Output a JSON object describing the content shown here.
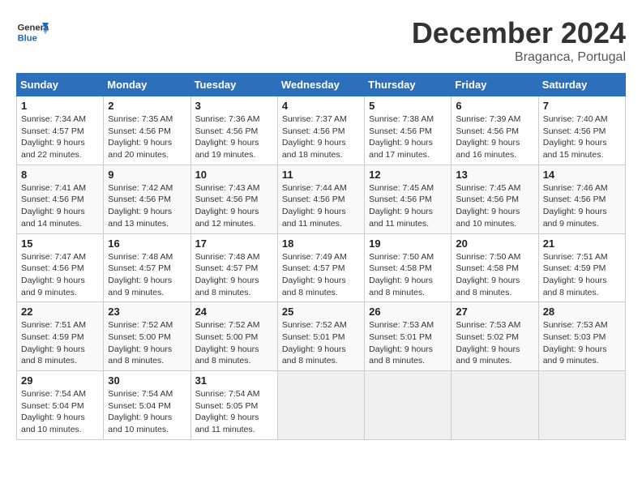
{
  "header": {
    "logo_general": "General",
    "logo_blue": "Blue",
    "month_title": "December 2024",
    "location": "Braganca, Portugal"
  },
  "weekdays": [
    "Sunday",
    "Monday",
    "Tuesday",
    "Wednesday",
    "Thursday",
    "Friday",
    "Saturday"
  ],
  "weeks": [
    [
      {
        "day": "1",
        "sunrise": "Sunrise: 7:34 AM",
        "sunset": "Sunset: 4:57 PM",
        "daylight": "Daylight: 9 hours and 22 minutes."
      },
      {
        "day": "2",
        "sunrise": "Sunrise: 7:35 AM",
        "sunset": "Sunset: 4:56 PM",
        "daylight": "Daylight: 9 hours and 20 minutes."
      },
      {
        "day": "3",
        "sunrise": "Sunrise: 7:36 AM",
        "sunset": "Sunset: 4:56 PM",
        "daylight": "Daylight: 9 hours and 19 minutes."
      },
      {
        "day": "4",
        "sunrise": "Sunrise: 7:37 AM",
        "sunset": "Sunset: 4:56 PM",
        "daylight": "Daylight: 9 hours and 18 minutes."
      },
      {
        "day": "5",
        "sunrise": "Sunrise: 7:38 AM",
        "sunset": "Sunset: 4:56 PM",
        "daylight": "Daylight: 9 hours and 17 minutes."
      },
      {
        "day": "6",
        "sunrise": "Sunrise: 7:39 AM",
        "sunset": "Sunset: 4:56 PM",
        "daylight": "Daylight: 9 hours and 16 minutes."
      },
      {
        "day": "7",
        "sunrise": "Sunrise: 7:40 AM",
        "sunset": "Sunset: 4:56 PM",
        "daylight": "Daylight: 9 hours and 15 minutes."
      }
    ],
    [
      {
        "day": "8",
        "sunrise": "Sunrise: 7:41 AM",
        "sunset": "Sunset: 4:56 PM",
        "daylight": "Daylight: 9 hours and 14 minutes."
      },
      {
        "day": "9",
        "sunrise": "Sunrise: 7:42 AM",
        "sunset": "Sunset: 4:56 PM",
        "daylight": "Daylight: 9 hours and 13 minutes."
      },
      {
        "day": "10",
        "sunrise": "Sunrise: 7:43 AM",
        "sunset": "Sunset: 4:56 PM",
        "daylight": "Daylight: 9 hours and 12 minutes."
      },
      {
        "day": "11",
        "sunrise": "Sunrise: 7:44 AM",
        "sunset": "Sunset: 4:56 PM",
        "daylight": "Daylight: 9 hours and 11 minutes."
      },
      {
        "day": "12",
        "sunrise": "Sunrise: 7:45 AM",
        "sunset": "Sunset: 4:56 PM",
        "daylight": "Daylight: 9 hours and 11 minutes."
      },
      {
        "day": "13",
        "sunrise": "Sunrise: 7:45 AM",
        "sunset": "Sunset: 4:56 PM",
        "daylight": "Daylight: 9 hours and 10 minutes."
      },
      {
        "day": "14",
        "sunrise": "Sunrise: 7:46 AM",
        "sunset": "Sunset: 4:56 PM",
        "daylight": "Daylight: 9 hours and 9 minutes."
      }
    ],
    [
      {
        "day": "15",
        "sunrise": "Sunrise: 7:47 AM",
        "sunset": "Sunset: 4:56 PM",
        "daylight": "Daylight: 9 hours and 9 minutes."
      },
      {
        "day": "16",
        "sunrise": "Sunrise: 7:48 AM",
        "sunset": "Sunset: 4:57 PM",
        "daylight": "Daylight: 9 hours and 9 minutes."
      },
      {
        "day": "17",
        "sunrise": "Sunrise: 7:48 AM",
        "sunset": "Sunset: 4:57 PM",
        "daylight": "Daylight: 9 hours and 8 minutes."
      },
      {
        "day": "18",
        "sunrise": "Sunrise: 7:49 AM",
        "sunset": "Sunset: 4:57 PM",
        "daylight": "Daylight: 9 hours and 8 minutes."
      },
      {
        "day": "19",
        "sunrise": "Sunrise: 7:50 AM",
        "sunset": "Sunset: 4:58 PM",
        "daylight": "Daylight: 9 hours and 8 minutes."
      },
      {
        "day": "20",
        "sunrise": "Sunrise: 7:50 AM",
        "sunset": "Sunset: 4:58 PM",
        "daylight": "Daylight: 9 hours and 8 minutes."
      },
      {
        "day": "21",
        "sunrise": "Sunrise: 7:51 AM",
        "sunset": "Sunset: 4:59 PM",
        "daylight": "Daylight: 9 hours and 8 minutes."
      }
    ],
    [
      {
        "day": "22",
        "sunrise": "Sunrise: 7:51 AM",
        "sunset": "Sunset: 4:59 PM",
        "daylight": "Daylight: 9 hours and 8 minutes."
      },
      {
        "day": "23",
        "sunrise": "Sunrise: 7:52 AM",
        "sunset": "Sunset: 5:00 PM",
        "daylight": "Daylight: 9 hours and 8 minutes."
      },
      {
        "day": "24",
        "sunrise": "Sunrise: 7:52 AM",
        "sunset": "Sunset: 5:00 PM",
        "daylight": "Daylight: 9 hours and 8 minutes."
      },
      {
        "day": "25",
        "sunrise": "Sunrise: 7:52 AM",
        "sunset": "Sunset: 5:01 PM",
        "daylight": "Daylight: 9 hours and 8 minutes."
      },
      {
        "day": "26",
        "sunrise": "Sunrise: 7:53 AM",
        "sunset": "Sunset: 5:01 PM",
        "daylight": "Daylight: 9 hours and 8 minutes."
      },
      {
        "day": "27",
        "sunrise": "Sunrise: 7:53 AM",
        "sunset": "Sunset: 5:02 PM",
        "daylight": "Daylight: 9 hours and 9 minutes."
      },
      {
        "day": "28",
        "sunrise": "Sunrise: 7:53 AM",
        "sunset": "Sunset: 5:03 PM",
        "daylight": "Daylight: 9 hours and 9 minutes."
      }
    ],
    [
      {
        "day": "29",
        "sunrise": "Sunrise: 7:54 AM",
        "sunset": "Sunset: 5:04 PM",
        "daylight": "Daylight: 9 hours and 10 minutes."
      },
      {
        "day": "30",
        "sunrise": "Sunrise: 7:54 AM",
        "sunset": "Sunset: 5:04 PM",
        "daylight": "Daylight: 9 hours and 10 minutes."
      },
      {
        "day": "31",
        "sunrise": "Sunrise: 7:54 AM",
        "sunset": "Sunset: 5:05 PM",
        "daylight": "Daylight: 9 hours and 11 minutes."
      },
      null,
      null,
      null,
      null
    ]
  ]
}
